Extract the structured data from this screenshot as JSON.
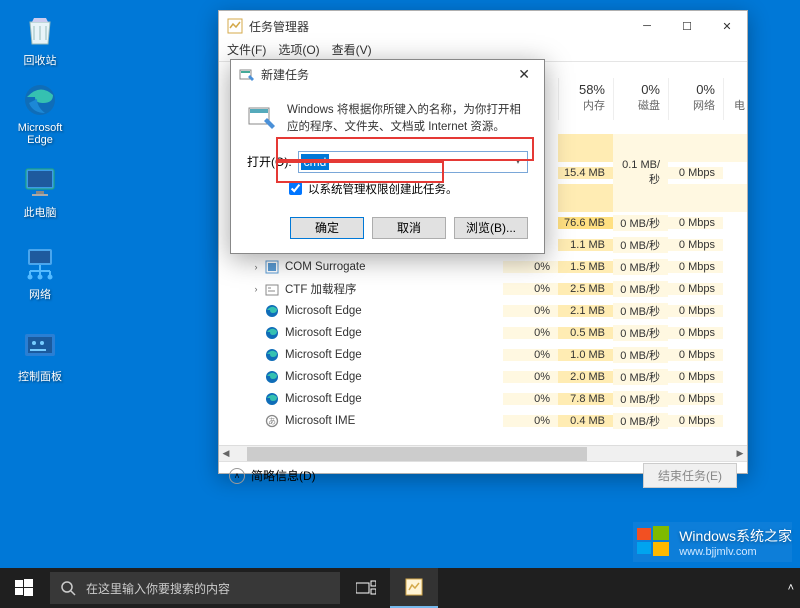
{
  "desktop": {
    "icons": [
      {
        "name": "recycle-bin",
        "label": "回收站"
      },
      {
        "name": "edge",
        "label": "Microsoft Edge"
      },
      {
        "name": "this-pc",
        "label": "此电脑"
      },
      {
        "name": "network",
        "label": "网络"
      },
      {
        "name": "control-panel",
        "label": "控制面板"
      }
    ]
  },
  "taskmgr": {
    "title": "任务管理器",
    "menu": {
      "file": "文件(F)",
      "options": "选项(O)",
      "view": "查看(V)"
    },
    "columns": {
      "cpu_pct": "",
      "cpu_label": "",
      "mem_pct": "58%",
      "mem_label": "内存",
      "disk_pct": "0%",
      "disk_label": "磁盘",
      "net_pct": "0%",
      "net_label": "网络",
      "extra": "电"
    },
    "rows": [
      {
        "gap": true
      },
      {
        "name": "",
        "cpu": "",
        "mem": "15.4 MB",
        "disk": "0.1 MB/秒",
        "net": "0 Mbps"
      },
      {
        "gap": true
      },
      {
        "name": "",
        "cpu": "",
        "mem": "76.6 MB",
        "mem_high": true,
        "disk": "0 MB/秒",
        "net": "0 Mbps"
      },
      {
        "name": "",
        "cpu": "",
        "mem": "1.1 MB",
        "disk": "0 MB/秒",
        "net": "0 Mbps"
      },
      {
        "expand": "›",
        "icon": "com",
        "name": "COM Surrogate",
        "cpu": "0%",
        "mem": "1.5 MB",
        "disk": "0 MB/秒",
        "net": "0 Mbps",
        "indent": true
      },
      {
        "expand": "›",
        "icon": "ctf",
        "name": "CTF 加载程序",
        "cpu": "0%",
        "mem": "2.5 MB",
        "disk": "0 MB/秒",
        "net": "0 Mbps",
        "indent": true
      },
      {
        "icon": "edge",
        "name": "Microsoft Edge",
        "cpu": "0%",
        "mem": "2.1 MB",
        "disk": "0 MB/秒",
        "net": "0 Mbps",
        "indent": true
      },
      {
        "icon": "edge",
        "name": "Microsoft Edge",
        "cpu": "0%",
        "mem": "0.5 MB",
        "disk": "0 MB/秒",
        "net": "0 Mbps",
        "indent": true
      },
      {
        "icon": "edge",
        "name": "Microsoft Edge",
        "cpu": "0%",
        "mem": "1.0 MB",
        "disk": "0 MB/秒",
        "net": "0 Mbps",
        "indent": true
      },
      {
        "icon": "edge",
        "name": "Microsoft Edge",
        "cpu": "0%",
        "mem": "2.0 MB",
        "disk": "0 MB/秒",
        "net": "0 Mbps",
        "indent": true
      },
      {
        "icon": "edge",
        "name": "Microsoft Edge",
        "cpu": "0%",
        "mem": "7.8 MB",
        "disk": "0 MB/秒",
        "net": "0 Mbps",
        "indent": true
      },
      {
        "icon": "ime",
        "name": "Microsoft IME",
        "cpu": "0%",
        "mem": "0.4 MB",
        "disk": "0 MB/秒",
        "net": "0 Mbps",
        "indent": true
      }
    ],
    "footer": {
      "fewer": "简略信息(D)",
      "endtask": "结束任务(E)"
    }
  },
  "newtask": {
    "title": "新建任务",
    "desc": "Windows 将根据你所键入的名称，为你打开相应的程序、文件夹、文档或 Internet 资源。",
    "open_label": "打开(O):",
    "open_value": "cmd",
    "admin_check": "以系统管理权限创建此任务。",
    "buttons": {
      "ok": "确定",
      "cancel": "取消",
      "browse": "浏览(B)..."
    }
  },
  "taskbar": {
    "search_placeholder": "在这里输入你要搜索的内容"
  },
  "watermark": {
    "brand": "Windows",
    "sub": "系统之家",
    "url": "www.bjjmlv.com"
  }
}
